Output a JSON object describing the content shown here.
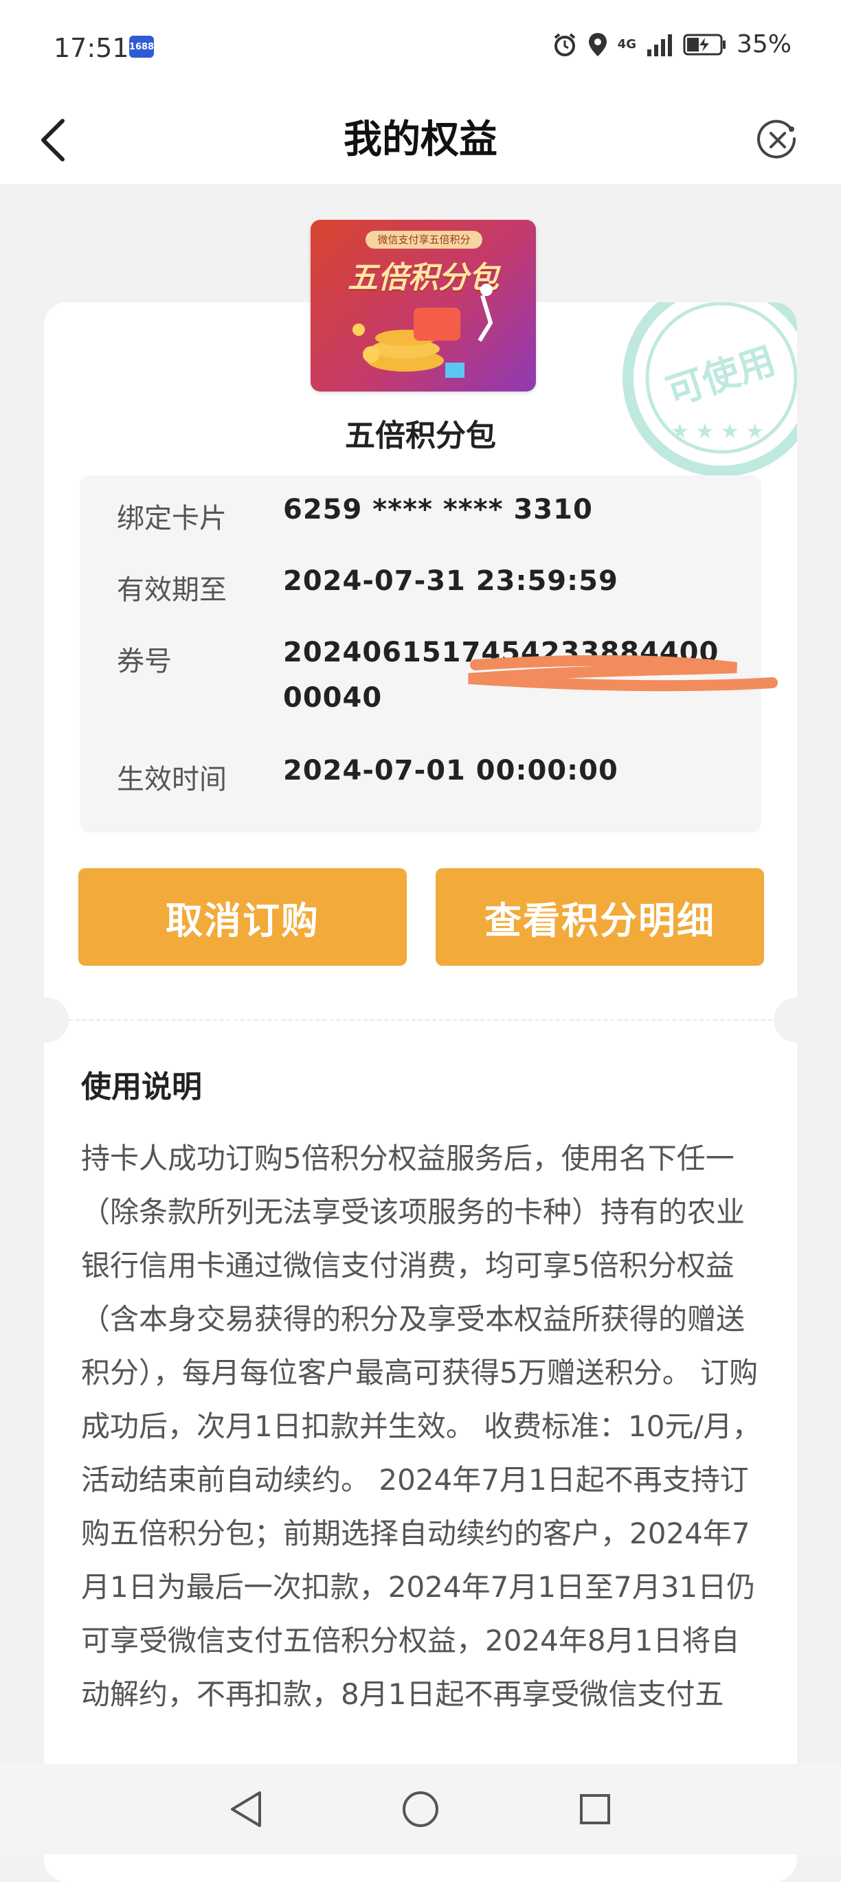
{
  "status_bar": {
    "time": "17:51",
    "app_badge": "1688",
    "network": "4G",
    "battery": "35%"
  },
  "header": {
    "title": "我的权益"
  },
  "card": {
    "stamp_text": "可使用",
    "product_image": {
      "subtitle": "微信支付享五倍积分",
      "title": "五倍积分包"
    },
    "product_name": "五倍积分包",
    "info": [
      {
        "label": "绑定卡片",
        "value": "6259 **** **** 3310"
      },
      {
        "label": "有效期至",
        "value": "2024-07-31 23:59:59"
      },
      {
        "label": "券号",
        "value": "202406151745423388440000040"
      },
      {
        "label": "生效时间",
        "value": "2024-07-01 00:00:00"
      }
    ],
    "buttons": {
      "cancel": "取消订购",
      "detail": "查看积分明细"
    },
    "usage": {
      "title": "使用说明",
      "text": "持卡人成功订购5倍积分权益服务后，使用名下任一（除条款所列无法享受该项服务的卡种）持有的农业银行信用卡通过微信支付消费，均可享5倍积分权益（含本身交易获得的积分及享受本权益所获得的赠送积分），每月每位客户最高可获得5万赠送积分。 订购成功后，次月1日扣款并生效。 收费标准：10元/月，活动结束前自动续约。 2024年7月1日起不再支持订购五倍积分包；前期选择自动续约的客户，2024年7月1日为最后一次扣款，2024年7月1日至7月31日仍可享受微信支付五倍积分权益，2024年8月1日将自动解约，不再扣款，8月1日起不再享受微信支付五"
    }
  },
  "colors": {
    "accent": "#f2aa3a",
    "stamp": "#7fd6c4",
    "background": "#f2f2f2"
  }
}
